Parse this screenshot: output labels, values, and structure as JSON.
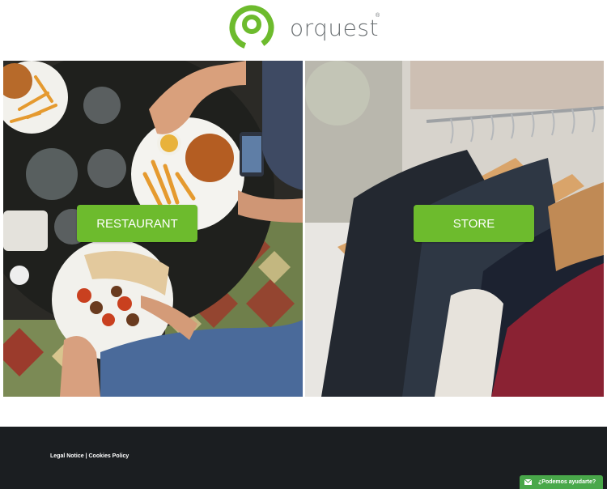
{
  "brand": {
    "name": "orquest",
    "reg_mark": "®",
    "color": "#6dbb2d"
  },
  "panels": {
    "restaurant": {
      "label": "RESTAURANT"
    },
    "store": {
      "label": "STORE"
    }
  },
  "footer": {
    "legal_notice": "Legal Notice",
    "separator": "|",
    "cookies_policy": "Cookies Policy",
    "help_label": "¿Podemos ayudarte?",
    "help_icon": "mail-icon"
  },
  "colors": {
    "accent": "#6dbb2d",
    "footer_bg": "#1b1e21",
    "help_bg": "#49a84a"
  }
}
